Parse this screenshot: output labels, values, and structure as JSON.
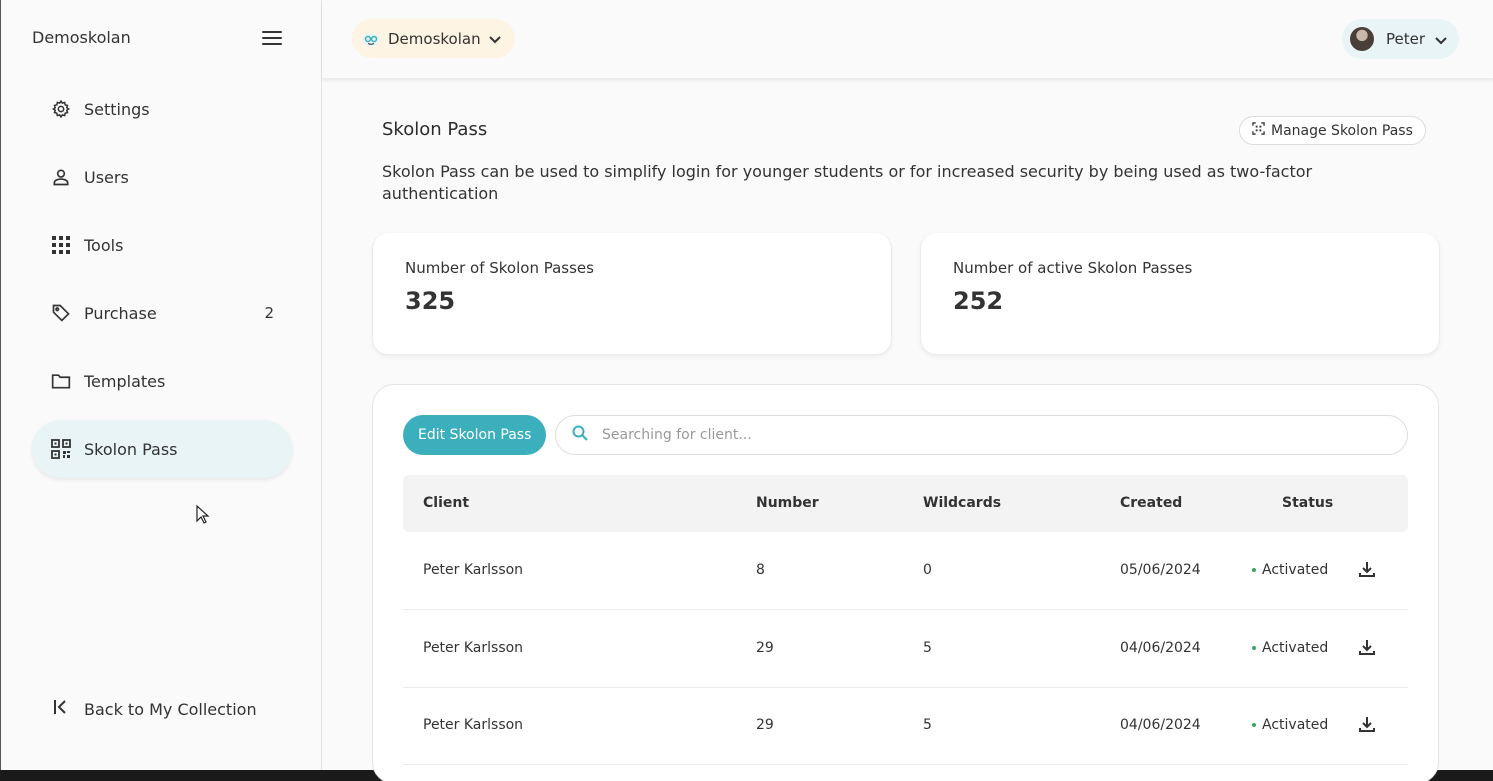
{
  "sidebar": {
    "brand": "Demoskolan",
    "items": [
      {
        "label": "Settings",
        "icon": "gear-icon"
      },
      {
        "label": "Users",
        "icon": "user-icon"
      },
      {
        "label": "Tools",
        "icon": "grid-icon"
      },
      {
        "label": "Purchase",
        "icon": "tag-icon",
        "badge": "2"
      },
      {
        "label": "Templates",
        "icon": "folder-icon"
      },
      {
        "label": "Skolon Pass",
        "icon": "qr-icon",
        "active": true
      }
    ],
    "back_label": "Back to My Collection"
  },
  "topbar": {
    "school": "Demoskolan",
    "user": "Peter"
  },
  "page": {
    "title": "Skolon Pass",
    "manage_label": "Manage Skolon Pass",
    "description": "Skolon Pass can be used to simplify login for younger students or for increased security by being used as two-factor authentication"
  },
  "stats": [
    {
      "label": "Number of Skolon Passes",
      "value": "325"
    },
    {
      "label": "Number of active Skolon Passes",
      "value": "252"
    }
  ],
  "table": {
    "edit_label": "Edit Skolon Pass",
    "search_placeholder": "Searching for client...",
    "columns": [
      "Client",
      "Number",
      "Wildcards",
      "Created",
      "Status"
    ],
    "rows": [
      {
        "client": "Peter Karlsson",
        "number": "8",
        "wildcards": "0",
        "created": "05/06/2024",
        "status": "Activated"
      },
      {
        "client": "Peter Karlsson",
        "number": "29",
        "wildcards": "5",
        "created": "04/06/2024",
        "status": "Activated"
      },
      {
        "client": "Peter Karlsson",
        "number": "29",
        "wildcards": "5",
        "created": "04/06/2024",
        "status": "Activated"
      }
    ]
  },
  "colors": {
    "accent": "#3bb0bc",
    "active_nav_bg": "#e8f4f6",
    "school_pill_bg": "#fdf4e3",
    "status_dot": "#3ba55d"
  }
}
